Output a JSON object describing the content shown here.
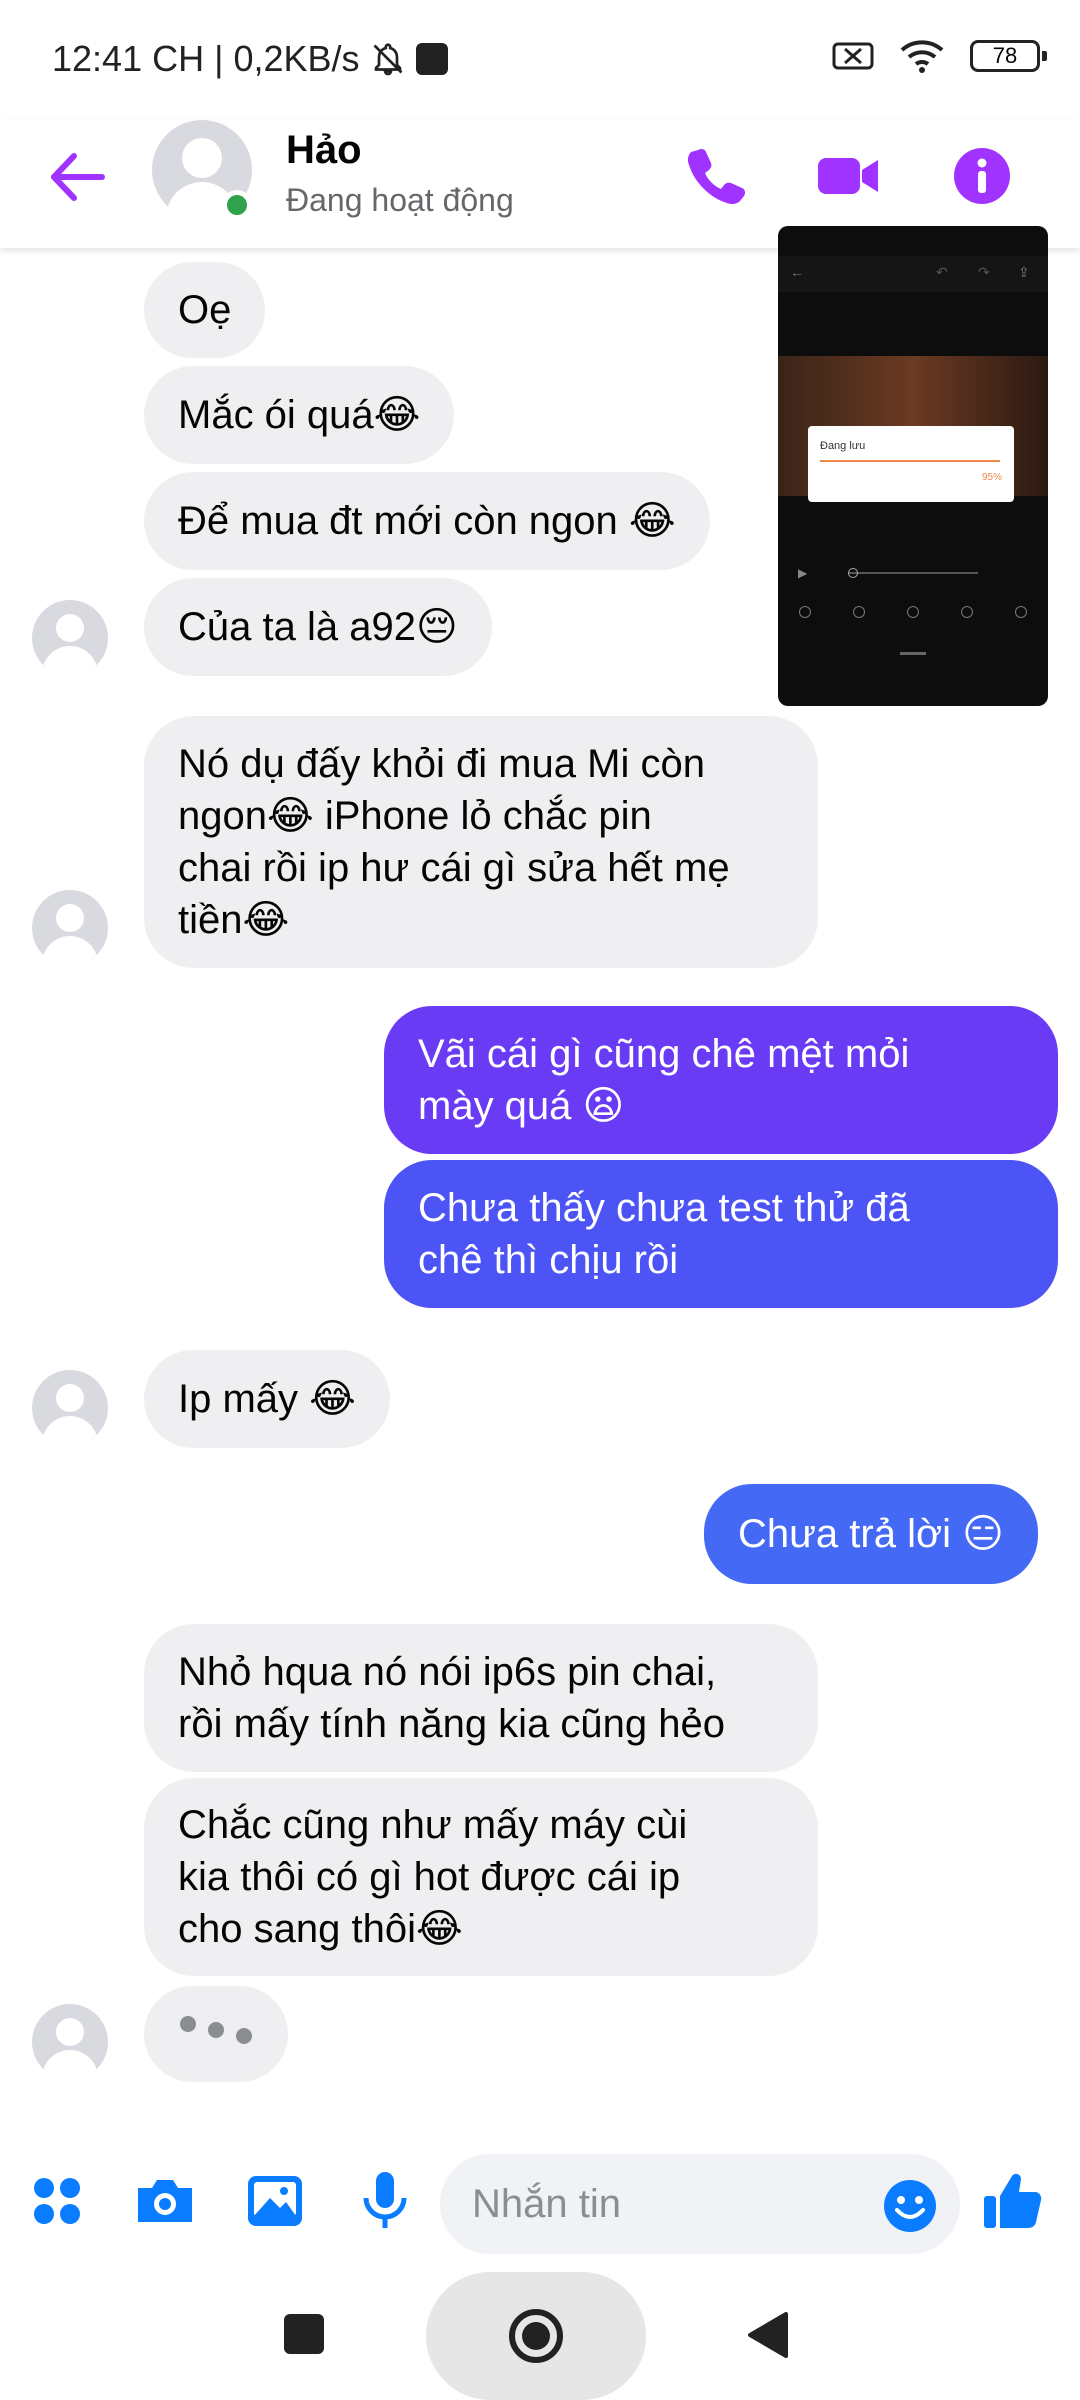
{
  "status_bar": {
    "time_net": "12:41 CH | 0,2KB/s",
    "battery": "78"
  },
  "header": {
    "name": "Hảo",
    "status": "Đang hoạt động"
  },
  "pip": {
    "dialog_title": "Đang lưu",
    "dialog_percent": "95%"
  },
  "colors": {
    "accent": "#a033ff",
    "blue": "#0a7cff",
    "out_top": "#6a3bf5",
    "out_mid": "#4c54f5",
    "out_bottom": "#4469f5",
    "incoming": "#efeff1",
    "online": "#31a24c"
  },
  "messages": [
    {
      "dir": "in",
      "text": "Oẹ"
    },
    {
      "dir": "in",
      "text": "Mắc ói quá😂"
    },
    {
      "dir": "in",
      "text": "Để mua đt mới còn ngon 😂"
    },
    {
      "dir": "in",
      "text": "Của ta là a92😔"
    },
    {
      "dir": "in",
      "text": "Nó dụ đấy khỏi đi mua Mi còn\nngon😂 iPhone lỏ chắc pin\nchai rồi ip hư cái gì sửa hết mẹ\ntiền😂"
    },
    {
      "dir": "out",
      "text": "Vãi cái gì cũng chê mệt mỏi\nmày quá 😦"
    },
    {
      "dir": "out",
      "text": "Chưa thấy chưa test thử đã\nchê thì chịu rồi"
    },
    {
      "dir": "in",
      "text": "Ip mấy 😂"
    },
    {
      "dir": "out",
      "text": "Chưa trả lời 😑"
    },
    {
      "dir": "in",
      "text": "Nhỏ hqua nó nói ip6s pin chai,\nrồi mấy tính năng kia cũng hẻo"
    },
    {
      "dir": "in",
      "text": "Chắc cũng như mấy máy cùi\nkia thôi có gì hot được cái ip\ncho sang thôi😂"
    }
  ],
  "composer": {
    "placeholder": "Nhắn tin"
  },
  "icons": {
    "back": "arrow-left",
    "call": "phone",
    "video": "video-camera",
    "info": "info",
    "apps": "four-dots",
    "camera": "camera",
    "gallery": "image",
    "mic": "microphone",
    "emoji": "smiley",
    "like": "thumbs-up",
    "nav_recents": "square",
    "nav_home": "circle",
    "nav_back": "triangle"
  }
}
